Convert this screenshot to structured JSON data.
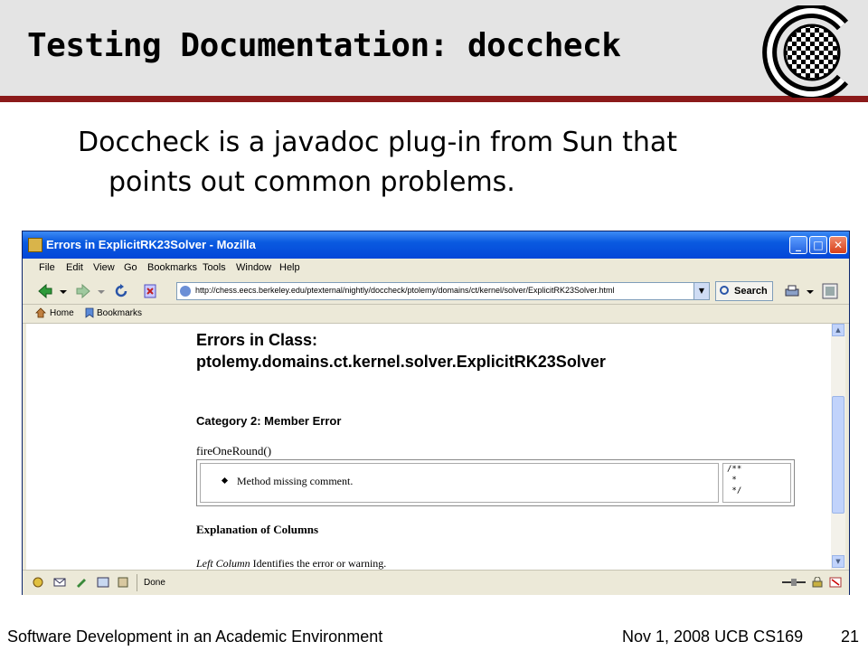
{
  "slide": {
    "title": "Testing Documentation: doccheck",
    "body_line1": "Doccheck is a javadoc plug-in from Sun that",
    "body_line2": "points out common problems.",
    "footer_left": "Software Development in an Academic Environment",
    "footer_right": "Nov 1, 2008 UCB CS169",
    "page_number": "21",
    "header_bg": "#e4e4e4",
    "accent_rule_color": "#8b1a1a"
  },
  "browser": {
    "window_title": "Errors in ExplicitRK23Solver - Mozilla",
    "menu": [
      "File",
      "Edit",
      "View",
      "Go",
      "Bookmarks",
      "Tools",
      "Window",
      "Help"
    ],
    "url": "http://chess.eecs.berkeley.edu/ptexternal/nightly/doccheck/ptolemy/domains/ct/kernel/solver/ExplicitRK23Solver.html",
    "search_label": "Search",
    "bookmarks": [
      "Home",
      "Bookmarks"
    ],
    "status_text": "Done",
    "titlebar_color": "#0a5ae0"
  },
  "page": {
    "heading_line1": "Errors in Class:",
    "heading_line2": "ptolemy.domains.ct.kernel.solver.ExplicitRK23Solver",
    "category": "Category 2: Member Error",
    "method": "fireOneRound()",
    "error_item": "Method missing comment.",
    "code_lines": [
      "/**",
      " *",
      " */"
    ],
    "explanation_heading": "Explanation of Columns",
    "left_column_label": "Left Column",
    "left_column_text": "Identifies the error or warning."
  }
}
